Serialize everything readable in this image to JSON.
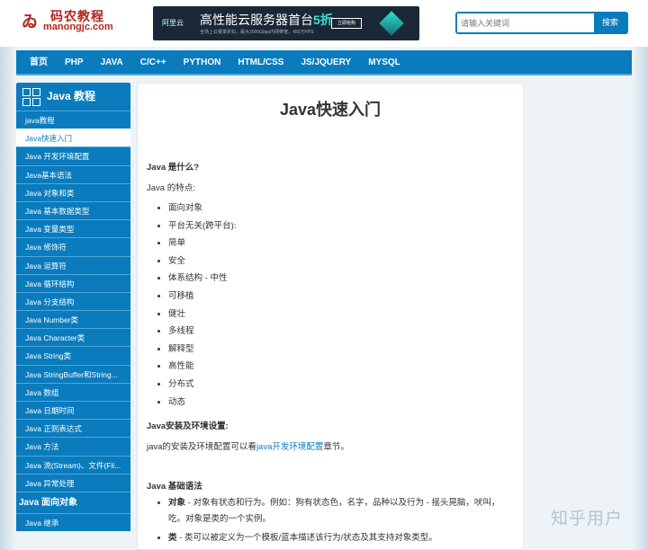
{
  "logo": {
    "name": "码农教程",
    "domain": "manongjc.com"
  },
  "ad": {
    "brand": "阿里云",
    "headline": "高性能云服务器首台",
    "discount": "5折",
    "sub": "全场上云赛季折扣，最大2000Gbps内网带宽，450万PPS",
    "button": "立即抢购"
  },
  "search": {
    "placeholder": "请输入关键词",
    "button": "搜索"
  },
  "nav": [
    "首页",
    "PHP",
    "JAVA",
    "C/C++",
    "PYTHON",
    "HTML/CSS",
    "JS/JQUERY",
    "MYSQL"
  ],
  "sidebar": {
    "title": "Java 教程",
    "items": [
      "java教程",
      "Java快速入门",
      "Java 开发环境配置",
      "Java基本语法",
      "Java 对象和类",
      "Java 基本数据类型",
      "Java 变量类型",
      "Java 修饰符",
      "Java 运算符",
      "Java 循环结构",
      "Java 分支结构",
      "Java Number类",
      "Java Character类",
      "Java String类",
      "Java StringBuffer和String...",
      "Java 数组",
      "Java 日期时间",
      "Java 正则表达式",
      "Java 方法",
      "Java 流(Stream)、文件(Fil...",
      "Java 异常处理"
    ],
    "group2": "Java 面向对象",
    "items2": [
      "Java 继承"
    ]
  },
  "content": {
    "title": "Java快速入门",
    "q1": "Java 是什么?",
    "features_label": "Java 的特点:",
    "features": [
      "面向对象",
      "平台无关(跨平台):",
      "简单",
      "安全",
      "体系结构 - 中性",
      "可移植",
      "健壮",
      "多线程",
      "解释型",
      "高性能",
      "分布式",
      "动态"
    ],
    "q2": "Java安装及环境设置:",
    "install_pre": "java的安装及环境配置可以看",
    "install_link": "java开发环境配置",
    "install_post": "章节。",
    "q3": "Java 基础语法",
    "basics": [
      {
        "term": "对象",
        "desc": " - 对象有状态和行为。例如：狗有状态色，名字，品种以及行为 - 摇头晃脑，吠叫，吃。对象是类的一个实例。"
      },
      {
        "term": "类",
        "desc": " - 类可以被定义为一个模板/蓝本描述该行为/状态及其支持对象类型。"
      }
    ]
  },
  "watermark": "知乎用户"
}
